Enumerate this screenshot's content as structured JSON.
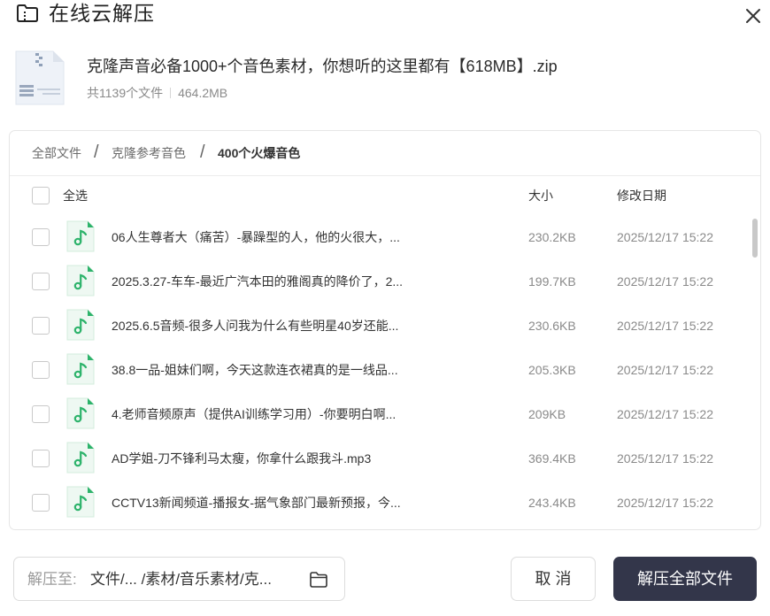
{
  "window": {
    "title": "在线云解压",
    "title_icon": "archive-icon",
    "close_icon": "close-icon"
  },
  "archive": {
    "name": "克隆声音必备1000+个音色素材，你想听的这里都有【618MB】.zip",
    "file_count": "共1139个文件",
    "total_size": "464.2MB",
    "thumb_icon": "zip-file-icon"
  },
  "breadcrumb": {
    "items": [
      {
        "label": "全部文件"
      },
      {
        "label": "克隆参考音色"
      },
      {
        "label": "400个火爆音色"
      }
    ],
    "separator": "/"
  },
  "list_header": {
    "select_all": "全选",
    "size": "大小",
    "modified": "修改日期"
  },
  "files": [
    {
      "name": "06人生尊者大（痛苦）-暴躁型的人，他的火很大，...",
      "size": "230.2KB",
      "date": "2025/12/17 15:22"
    },
    {
      "name": "2025.3.27-车车-最近广汽本田的雅阁真的降价了，2...",
      "size": "199.7KB",
      "date": "2025/12/17 15:22"
    },
    {
      "name": "2025.6.5音频-很多人问我为什么有些明星40岁还能...",
      "size": "230.6KB",
      "date": "2025/12/17 15:22"
    },
    {
      "name": "38.8一品-姐妹们啊，今天这款连衣裙真的是一线品...",
      "size": "205.3KB",
      "date": "2025/12/17 15:22"
    },
    {
      "name": "4.老师音频原声（提供AI训练学习用）-你要明白啊...",
      "size": "209KB",
      "date": "2025/12/17 15:22"
    },
    {
      "name": "AD学姐-刀不锋利马太瘦，你拿什么跟我斗.mp3",
      "size": "369.4KB",
      "date": "2025/12/17 15:22"
    },
    {
      "name": "CCTV13新闻频道-播报女-据气象部门最新预报，今...",
      "size": "243.4KB",
      "date": "2025/12/17 15:22"
    }
  ],
  "file_icon": "audio-file-icon",
  "destination": {
    "label": "解压至:",
    "path": "文件/... /素材/音乐素材/克...",
    "folder_icon": "folder-icon"
  },
  "buttons": {
    "cancel": "取 消",
    "extract_all": "解压全部文件"
  },
  "colors": {
    "primary_button": "#33364a",
    "audio_icon_green": "#2db36b",
    "muted_text": "#8a8a8a"
  }
}
